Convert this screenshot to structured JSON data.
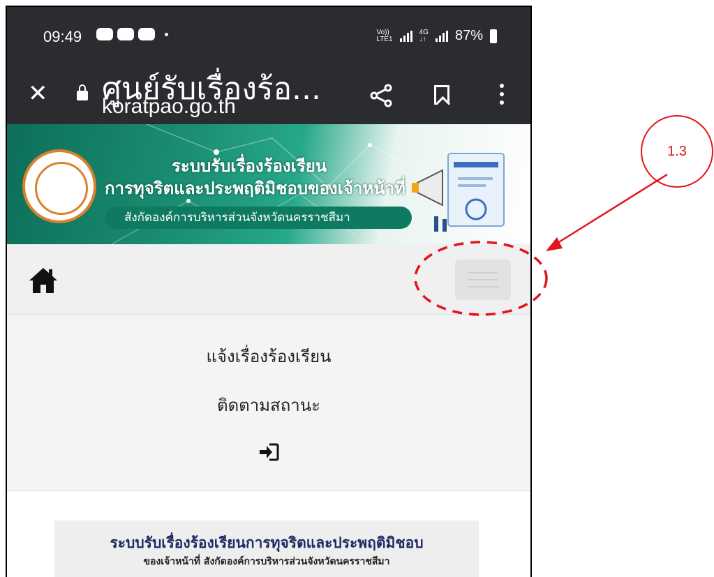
{
  "status_bar": {
    "time": "09:49",
    "network_top": "Vo))",
    "network_bottom": "LTE1",
    "data_top": "4G",
    "data_bottom": "↓↑",
    "battery": "87%"
  },
  "browser": {
    "page_title": "ศูนย์รับเรื่องร้อ...",
    "url": "koratpao.go.th",
    "close_icon": "close-icon",
    "lock_icon": "lock-icon",
    "share_icon": "share-icon",
    "bookmark_icon": "bookmark-icon",
    "menu_icon": "more-vert-icon"
  },
  "banner": {
    "line1": "ระบบรับเรื่องร้องเรียน",
    "line2": "การทุจริตและประพฤติมิชอบของเจ้าหน้าที่",
    "line3": "สังกัดองค์การบริหารส่วนจังหวัดนครราชสีมา"
  },
  "nav": {
    "home_icon": "home-icon",
    "hamburger_icon": "hamburger-icon"
  },
  "menu": {
    "items": [
      "แจ้งเรื่องร้องเรียน",
      "ติดตามสถานะ"
    ],
    "login_icon": "login-icon"
  },
  "card": {
    "title": "ระบบรับเรื่องร้องเรียนการทุจริตและประพฤติมิชอบ",
    "subtitle": "ของเจ้าหน้าที่ สังกัดองค์การบริหารส่วนจังหวัดนครราชสีมา"
  },
  "annotation": {
    "label": "1.3",
    "color": "#e3141b"
  }
}
